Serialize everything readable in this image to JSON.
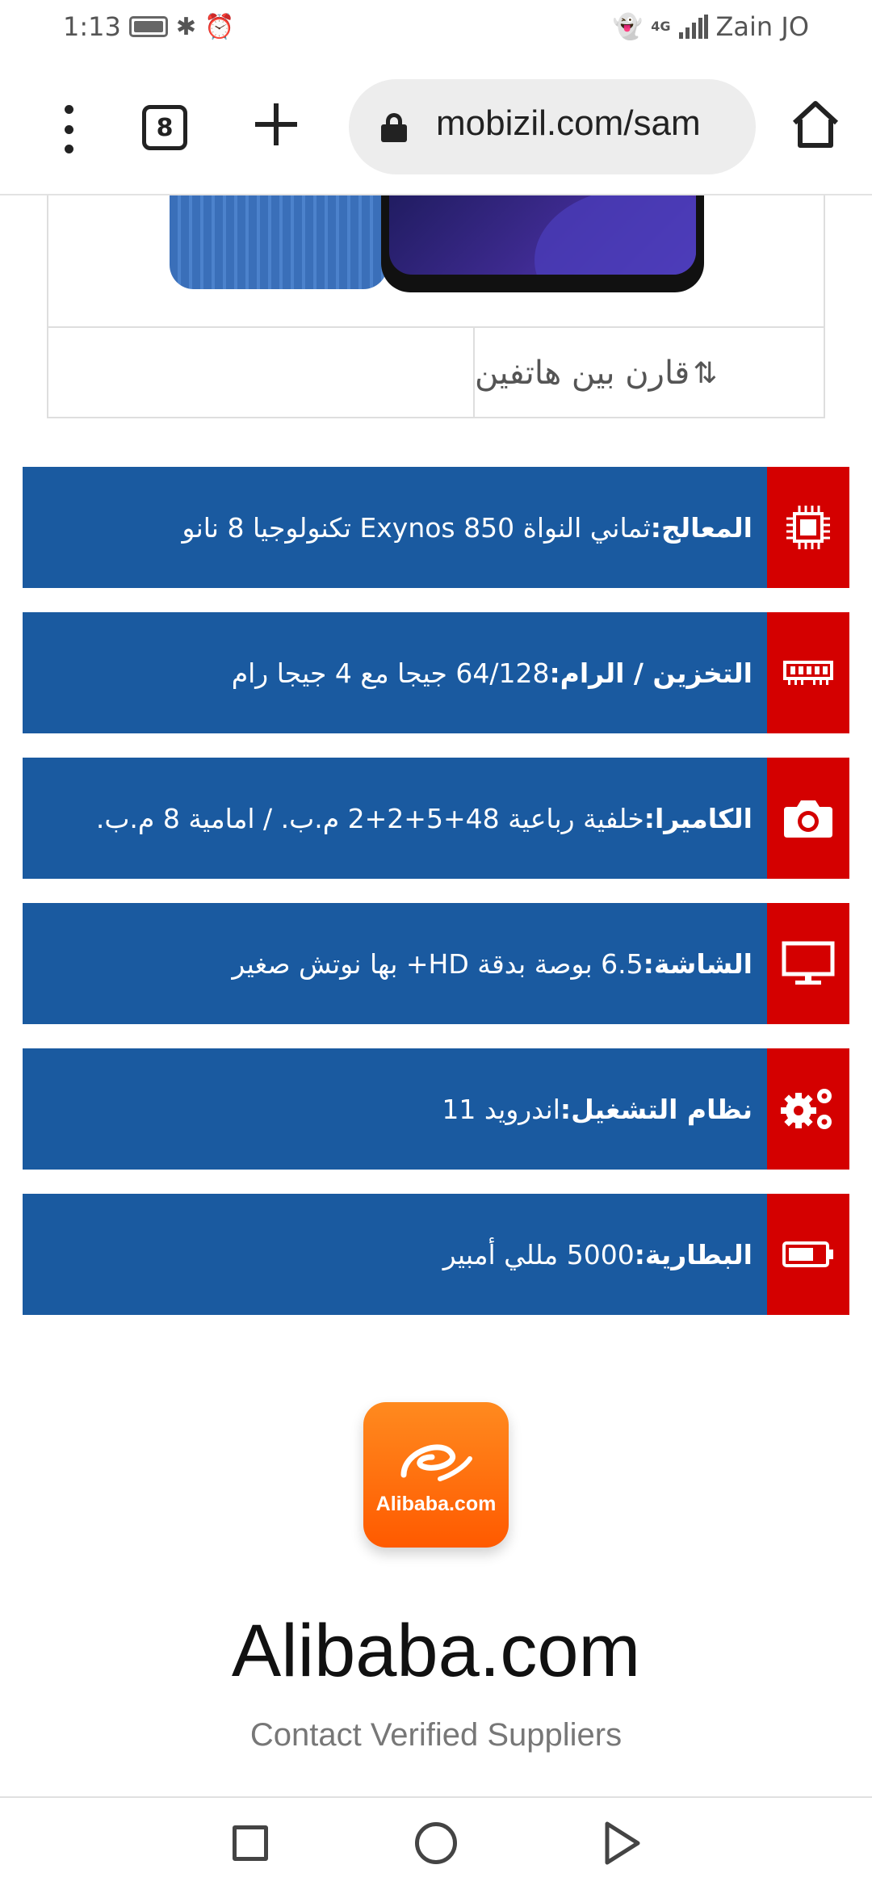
{
  "status_bar": {
    "time": "1:13",
    "carrier": "Zain JO",
    "network": "4G",
    "icons": [
      "battery-icon",
      "bluetooth-icon",
      "alarm-icon",
      "snapchat-icon",
      "signal-icon"
    ]
  },
  "browser": {
    "tab_count": "8",
    "url": "mobizil.com/sam",
    "icons": [
      "menu-icon",
      "tabs-icon",
      "new-tab-icon",
      "lock-icon",
      "home-icon"
    ]
  },
  "product": {
    "compare_label": "قارن بين هاتفين"
  },
  "specs": [
    {
      "icon": "processor-icon",
      "label": "المعالج:",
      "value": " ثماني النواة Exynos 850 تكنولوجيا 8 نانو"
    },
    {
      "icon": "memory-icon",
      "label": "التخزين / الرام:",
      "value": " 64/128 جيجا مع 4 جيجا رام"
    },
    {
      "icon": "camera-icon",
      "label": "الكاميرا:",
      "value": " خلفية رباعية 48+5+2+2 م.ب. / امامية 8 م.ب."
    },
    {
      "icon": "monitor-icon",
      "label": "الشاشة:",
      "value": " 6.5 بوصة بدقة HD+ بها نوتش صغير"
    },
    {
      "icon": "gears-icon",
      "label": "نظام التشغيل:",
      "value": " اندرويد 11"
    },
    {
      "icon": "battery-icon",
      "label": "البطارية:",
      "value": " 5000 مللي أمبير"
    }
  ],
  "ad": {
    "logo_text": "Alibaba.com",
    "title": "Alibaba.com",
    "subtitle": "Contact Verified Suppliers"
  },
  "colors": {
    "spec_row_bg": "#1a5aa0",
    "spec_icon_bg": "#d40000",
    "ad_orange": "#ff6a00"
  }
}
